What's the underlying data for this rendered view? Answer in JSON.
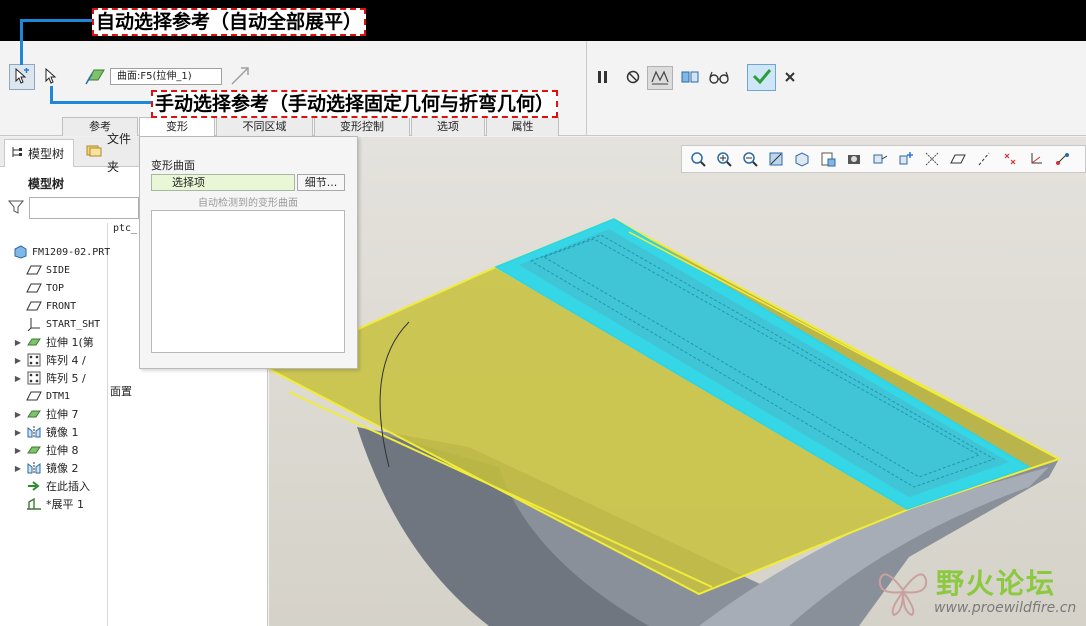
{
  "annotations": {
    "auto": "自动选择参考（自动全部展平）",
    "manual": "手动选择参考（手动选择固定几何与折弯几何）"
  },
  "ribbon": {
    "reference_field": "曲面:F5(拉伸_1)",
    "tabs": [
      "参考",
      "变形",
      "不同区域",
      "变形控制",
      "选项",
      "属性"
    ],
    "active_tab": "变形",
    "icons": [
      "auto-select-icon",
      "manual-select-icon",
      "surface-icon",
      "expand-arrow-icon",
      "pause-icon",
      "stop-icon",
      "preview-icon",
      "verify-icon",
      "glasses-icon",
      "checkmark-icon",
      "close-icon"
    ]
  },
  "left_panel": {
    "tab_model_tree": "模型树",
    "tab_folder": "文件夹",
    "tree_title": "模型树",
    "column_header": "ptc_",
    "side_value": "面置",
    "items": [
      {
        "label": "FM1209-02.PRT",
        "icon": "part-icon",
        "expander": ""
      },
      {
        "label": "SIDE",
        "icon": "datum-plane-icon",
        "expander": ""
      },
      {
        "label": "TOP",
        "icon": "datum-plane-icon",
        "expander": ""
      },
      {
        "label": "FRONT",
        "icon": "datum-plane-icon",
        "expander": ""
      },
      {
        "label": "START_SHT",
        "icon": "csys-icon",
        "expander": ""
      },
      {
        "label": "拉伸 1(第",
        "icon": "extrude-icon",
        "expander": "▶"
      },
      {
        "label": "阵列 4 / ",
        "icon": "pattern-icon",
        "expander": "▶"
      },
      {
        "label": "阵列 5 / ",
        "icon": "pattern-icon",
        "expander": "▶"
      },
      {
        "label": "DTM1",
        "icon": "datum-plane-icon",
        "expander": ""
      },
      {
        "label": "拉伸 7",
        "icon": "extrude-icon",
        "expander": "▶"
      },
      {
        "label": "镜像 1",
        "icon": "mirror-icon",
        "expander": "▶"
      },
      {
        "label": "拉伸 8",
        "icon": "extrude-icon",
        "expander": "▶"
      },
      {
        "label": "镜像 2",
        "icon": "mirror-icon",
        "expander": "▶"
      },
      {
        "label": "在此插入",
        "icon": "insert-arrow-icon",
        "expander": ""
      },
      {
        "label": "*展平 1",
        "icon": "flatten-icon",
        "expander": ""
      }
    ]
  },
  "popup": {
    "label": "变形曲面",
    "select_value": "选择项",
    "detail_button": "细节...",
    "hint": "自动检测到的变形曲面"
  },
  "view_toolbar": {
    "icons": [
      "zoom-fit-icon",
      "zoom-in-icon",
      "zoom-out-icon",
      "refit-icon",
      "display-style-icon",
      "saved-views-icon",
      "view-manager-icon",
      "perspective-icon",
      "spin-center-icon",
      "datum-display-icon",
      "plane-display-icon",
      "axis-display-icon",
      "point-display-icon",
      "csys-display-icon",
      "annotation-display-icon"
    ]
  },
  "watermark": {
    "title": "野火论坛",
    "url": "www.proewildfire.cn"
  },
  "colors": {
    "annotation_border": "#e01010",
    "connector": "#1e88d8",
    "part_yellow": "#c8c23c",
    "mesh_cyan": "#35d6e6",
    "ok_green": "#2e9e3a"
  }
}
